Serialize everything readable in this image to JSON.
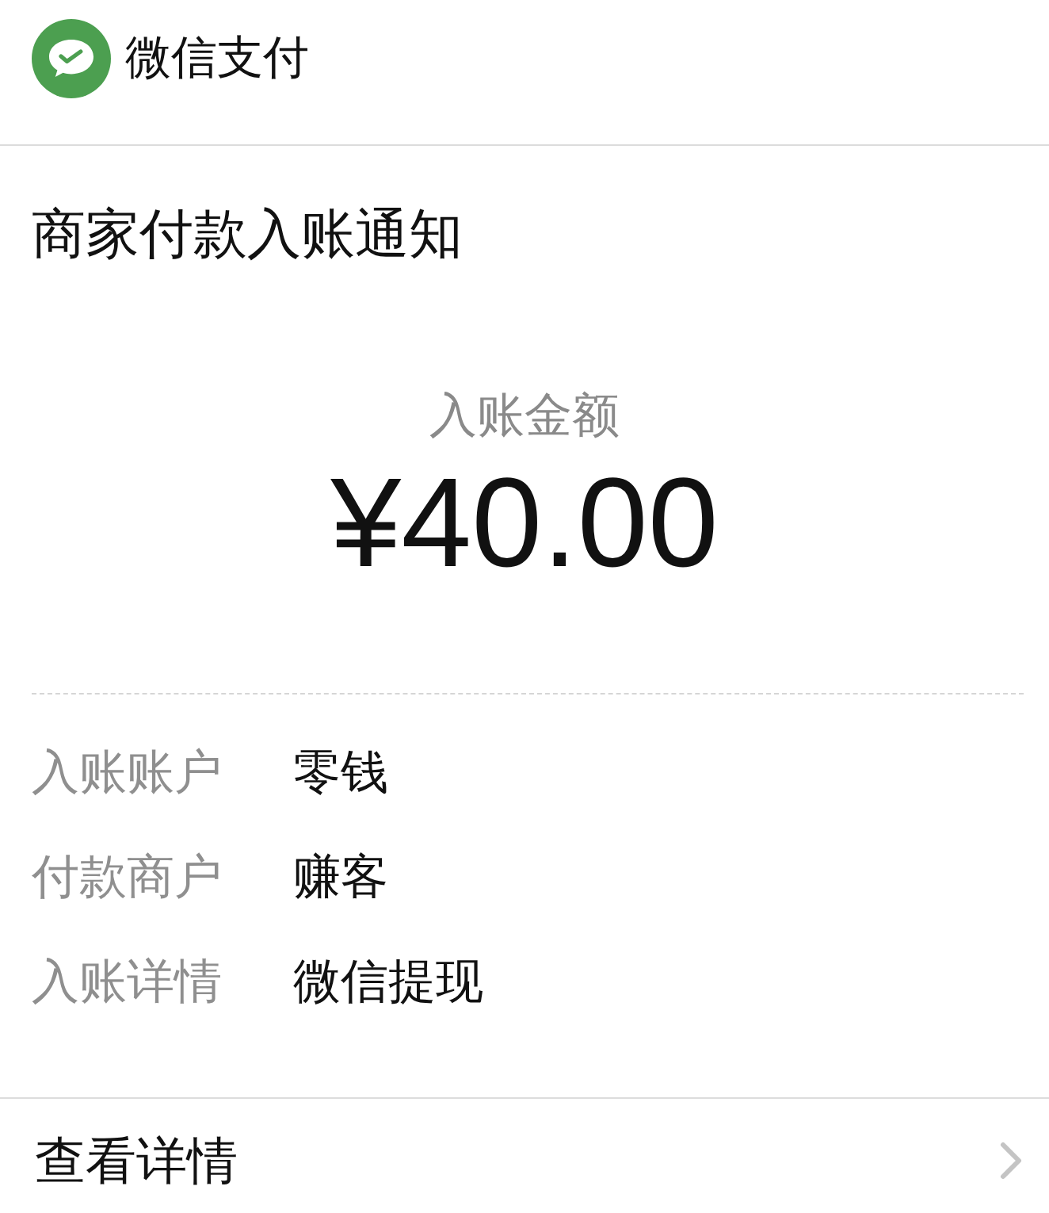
{
  "header": {
    "title": "微信支付"
  },
  "notice": {
    "title": "商家付款入账通知",
    "amount_label": "入账金额",
    "amount": "¥40.00"
  },
  "details": [
    {
      "label": "入账账户",
      "value": "零钱"
    },
    {
      "label": "付款商户",
      "value": "赚客"
    },
    {
      "label": "入账详情",
      "value": "微信提现"
    }
  ],
  "footer_link": {
    "label": "查看详情"
  }
}
